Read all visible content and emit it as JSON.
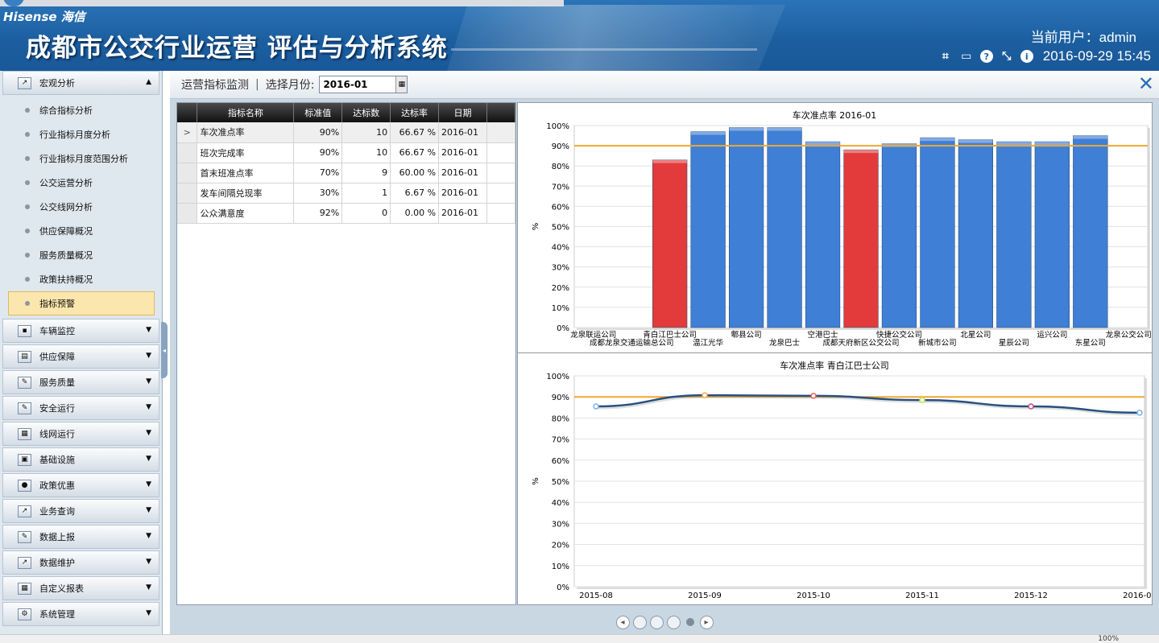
{
  "header": {
    "brand": "Hisense 海信",
    "title": "成都市公交行业运营 评估与分析系统",
    "user_label": "当前用户：admin",
    "datetime": "2016-09-29 15:45",
    "icons": [
      "crop-icon",
      "keyboard-icon",
      "help-icon",
      "resize-icon",
      "info-icon"
    ]
  },
  "sidebar": {
    "groups": [
      {
        "label": "宏观分析",
        "icon": "chart-icon",
        "expanded": true,
        "items": [
          "综合指标分析",
          "行业指标月度分析",
          "行业指标月度范围分析",
          "公交运营分析",
          "公交线网分析",
          "供应保障概况",
          "服务质量概况",
          "政策扶持概况",
          "指标预警"
        ],
        "active_item": "指标预警"
      },
      {
        "label": "车辆监控",
        "icon": "monitor-icon"
      },
      {
        "label": "供应保障",
        "icon": "supply-icon"
      },
      {
        "label": "服务质量",
        "icon": "edit-icon"
      },
      {
        "label": "安全运行",
        "icon": "edit-icon"
      },
      {
        "label": "线网运行",
        "icon": "grid-icon"
      },
      {
        "label": "基础设施",
        "icon": "box-icon"
      },
      {
        "label": "政策优惠",
        "icon": "globe-icon"
      },
      {
        "label": "业务查询",
        "icon": "trend-icon"
      },
      {
        "label": "数据上报",
        "icon": "edit-icon"
      },
      {
        "label": "数据维护",
        "icon": "trend-icon"
      },
      {
        "label": "自定义报表",
        "icon": "grid-icon"
      },
      {
        "label": "系统管理",
        "icon": "gear-icon"
      }
    ]
  },
  "main": {
    "title": "运营指标监测",
    "month_label": "选择月份:",
    "month_value": "2016-01",
    "table": {
      "headers": [
        "指标名称",
        "标准值",
        "达标数",
        "达标率",
        "日期"
      ],
      "rows": [
        {
          "sel": ">",
          "name": "车次准点率",
          "std": "90%",
          "count": "10",
          "rate": "66.67 %",
          "date": "2016-01"
        },
        {
          "sel": "",
          "name": "班次完成率",
          "std": "90%",
          "count": "10",
          "rate": "66.67 %",
          "date": "2016-01"
        },
        {
          "sel": "",
          "name": "首末班准点率",
          "std": "70%",
          "count": "9",
          "rate": "60.00 %",
          "date": "2016-01"
        },
        {
          "sel": "",
          "name": "发车间隔兑现率",
          "std": "30%",
          "count": "1",
          "rate": "6.67 %",
          "date": "2016-01"
        },
        {
          "sel": "",
          "name": "公众满意度",
          "std": "92%",
          "count": "0",
          "rate": "0.00 %",
          "date": "2016-01"
        }
      ]
    },
    "pager": {
      "prev": "◂",
      "next": "▸",
      "pages": 5,
      "current": 4
    }
  },
  "chart_data": [
    {
      "type": "bar",
      "title": "车次准点率 2016-01",
      "ylabel": "%",
      "ylim": [
        0,
        100
      ],
      "yticks": [
        "0%",
        "10%",
        "20%",
        "30%",
        "40%",
        "50%",
        "60%",
        "70%",
        "80%",
        "90%",
        "100%"
      ],
      "threshold": 90,
      "threshold_color": "#f0a830",
      "color_below": "#e33b3b",
      "color_above": "#3f7fd6",
      "categories": [
        "龙泉联运公司",
        "成都龙泉交通运输总公司",
        "青白江巴士公司",
        "温江光华",
        "郫县公司",
        "龙泉巴士",
        "空港巴士",
        "成都天府新区公交公司",
        "快捷公交公司",
        "新城市公司",
        "北星公司",
        "星辰公司",
        "运兴公司",
        "东星公司",
        "龙泉公交公司"
      ],
      "values": [
        0,
        0,
        83,
        97,
        99,
        99,
        92,
        88,
        91,
        94,
        93,
        92,
        92,
        95,
        0
      ]
    },
    {
      "type": "line",
      "title": "车次准点率 青白江巴士公司",
      "ylabel": "%",
      "ylim": [
        0,
        100
      ],
      "yticks": [
        "0%",
        "10%",
        "20%",
        "30%",
        "40%",
        "50%",
        "60%",
        "70%",
        "80%",
        "90%",
        "100%"
      ],
      "threshold": 90,
      "threshold_color": "#f0a830",
      "line_color": "#2a4f80",
      "x": [
        "2015-08",
        "2015-09",
        "2015-10",
        "2015-11",
        "2015-12",
        "2016-01"
      ],
      "values": [
        85.5,
        90.8,
        90.5,
        88.5,
        85.5,
        82.5
      ],
      "point_colors": [
        "#7ab0e8",
        "#f0b040",
        "#e85a5a",
        "#c8e050",
        "#c84a80",
        "#7ab0e8"
      ]
    }
  ],
  "statusbar": {
    "zoom": "100%"
  }
}
